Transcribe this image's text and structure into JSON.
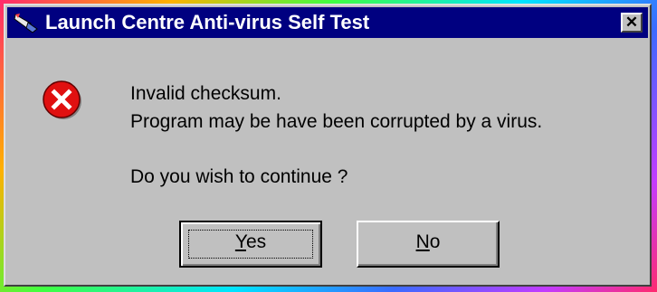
{
  "dialog": {
    "title": "Launch Centre Anti-virus Self Test",
    "close_glyph": "✕",
    "app_icon": "rocket-icon",
    "message_icon": "error-icon",
    "message_lines": [
      "Invalid checksum.",
      "Program may be have been corrupted by a virus."
    ],
    "question": "Do you wish to continue ?",
    "buttons": {
      "yes": {
        "label": "Yes",
        "accelerator": "Y",
        "rest": "es"
      },
      "no": {
        "label": "No",
        "accelerator": "N",
        "rest": "o"
      }
    }
  },
  "colors": {
    "titlebar": "#000080",
    "face": "#c0c0c0",
    "error_red": "#e01010"
  }
}
